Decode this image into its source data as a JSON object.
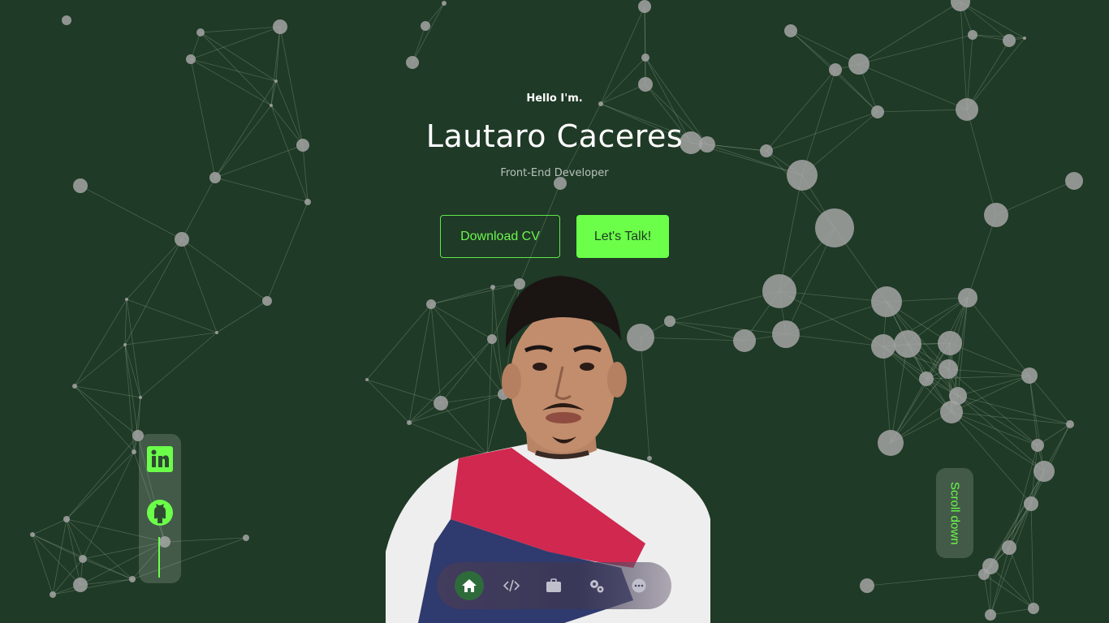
{
  "hero": {
    "greeting": "Hello I'm.",
    "name": "Lautaro Caceres",
    "role": "Front-End Developer"
  },
  "buttons": {
    "download_cv": "Download CV",
    "lets_talk": "Let's Talk!"
  },
  "socials": {
    "items": [
      {
        "icon": "linkedin-icon"
      },
      {
        "icon": "github-icon"
      }
    ]
  },
  "scroll": {
    "label": "Scroll down"
  },
  "nav": {
    "items": [
      {
        "icon": "home-icon",
        "active": true
      },
      {
        "icon": "code-icon",
        "active": false
      },
      {
        "icon": "briefcase-icon",
        "active": false
      },
      {
        "icon": "gears-icon",
        "active": false
      },
      {
        "icon": "chat-icon",
        "active": false
      }
    ]
  },
  "colors": {
    "background": "#1f3a26",
    "accent": "#6bff4a",
    "text": "#ffffff",
    "muted": "#b8c2ba",
    "node": "#9a9a9a"
  }
}
